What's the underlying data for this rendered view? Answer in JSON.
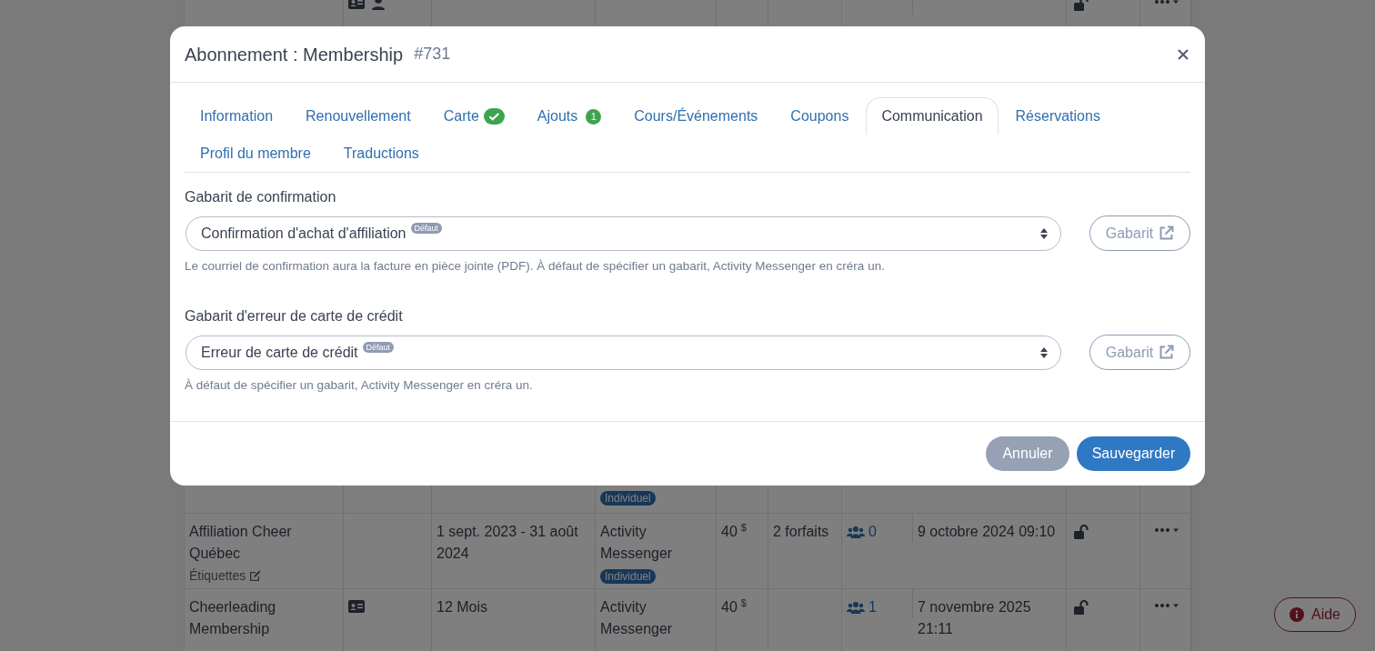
{
  "background_table": {
    "rows": [
      {
        "icons": [
          {
            "kind": "id-card"
          },
          {
            "kind": "user"
          }
        ]
      },
      {
        "type_badge": "Individuel"
      },
      {
        "name": "Affiliation Cheer Québec",
        "tags": "Étiquettes",
        "icons": [],
        "period": "1 sept. 2023 - 31 août 2024",
        "provider": "Activity Messenger",
        "type_badge": "Individuel",
        "price": "40",
        "currency": "$",
        "packages": "2 forfaits",
        "members": "0",
        "date": "9 octobre 2024 09:10"
      },
      {
        "name": "Cheerleading Membership",
        "icons": [
          {
            "kind": "id-card"
          }
        ],
        "period": "12 Mois",
        "provider": "Activity Messenger",
        "price": "40",
        "currency": "$",
        "members": "1",
        "date": "7 novembre 2025 21:11"
      }
    ]
  },
  "help_button": {
    "label": "Aide"
  },
  "dialog": {
    "title": "Abonnement : Membership",
    "record_id": "#731",
    "tabs": [
      {
        "label": "Information",
        "selected": false
      },
      {
        "label": "Renouvellement",
        "selected": false
      },
      {
        "label": "Carte",
        "selected": false,
        "badge": {
          "kind": "check"
        }
      },
      {
        "label": "Ajouts",
        "selected": false,
        "badge": {
          "kind": "count",
          "text": "1"
        }
      },
      {
        "label": "Cours/Événements",
        "selected": false
      },
      {
        "label": "Coupons",
        "selected": false
      },
      {
        "label": "Communication",
        "selected": true
      },
      {
        "label": "Réservations",
        "selected": false
      },
      {
        "label": "Profil du membre",
        "selected": false
      },
      {
        "label": "Traductions",
        "selected": false
      }
    ],
    "fields": [
      {
        "label": "Gabarit de confirmation",
        "value": "Confirmation d'achat d'affiliation",
        "default_badge": "Défaut",
        "help": "Le courriel de confirmation aura la facture en pièce jointe (PDF). À défaut de spécifier un gabarit, Activity Messenger en créra un.",
        "template_button": "Gabarit"
      },
      {
        "label": "Gabarit d'erreur de carte de crédit",
        "value": "Erreur de carte de crédit",
        "default_badge": "Défaut",
        "help": "À défaut de spécifier un gabarit, Activity Messenger en créra un.",
        "template_button": "Gabarit"
      }
    ],
    "buttons": [
      {
        "label": "Annuler",
        "kind": "secondary"
      },
      {
        "label": "Sauvegarder",
        "kind": "primary"
      }
    ]
  }
}
